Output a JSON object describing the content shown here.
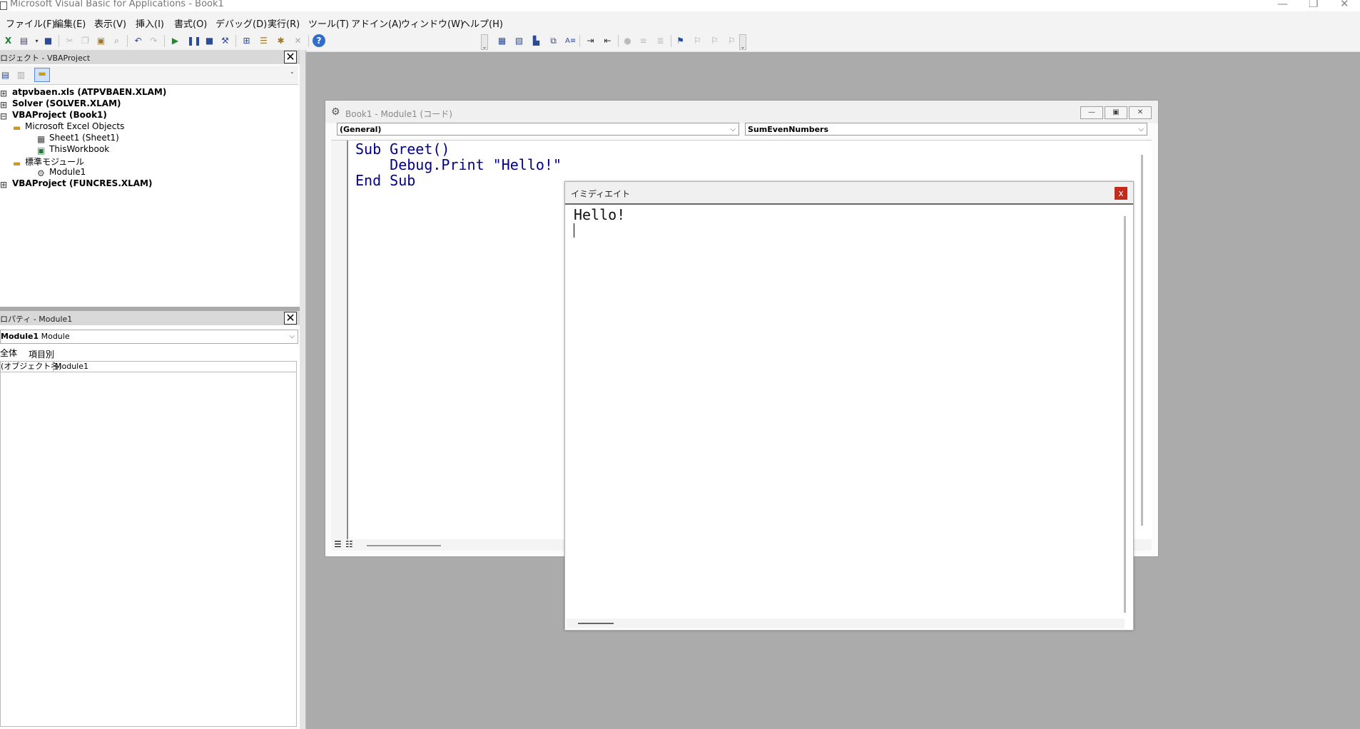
{
  "title_bar": {
    "title": "Microsoft Visual Basic for Applications - Book1"
  },
  "menu": [
    {
      "label": "ファイル(F)"
    },
    {
      "label": "編集(E)"
    },
    {
      "label": "表示(V)"
    },
    {
      "label": "挿入(I)"
    },
    {
      "label": "書式(O)"
    },
    {
      "label": "デバッグ(D)"
    },
    {
      "label": "実行(R)"
    },
    {
      "label": "ツール(T)"
    },
    {
      "label": "アドイン(A)"
    },
    {
      "label": "ウィンドウ(W)"
    },
    {
      "label": "ヘルプ(H)"
    }
  ],
  "project_pane": {
    "title": "ロジェクト - VBAProject",
    "tree": [
      {
        "label": "atpvbaen.xls (ATPVBAEN.XLAM)"
      },
      {
        "label": "Solver (SOLVER.XLAM)"
      },
      {
        "label": "VBAProject (Book1)"
      },
      {
        "label": "Microsoft Excel Objects"
      },
      {
        "label": "Sheet1 (Sheet1)"
      },
      {
        "label": "ThisWorkbook"
      },
      {
        "label": "標準モジュール"
      },
      {
        "label": "Module1"
      },
      {
        "label": "VBAProject (FUNCRES.XLAM)"
      }
    ]
  },
  "properties_pane": {
    "title": "ロパティ - Module1",
    "object_name": "Module1",
    "object_type": "Module",
    "tab_all": "全体",
    "tab_category": "項目別",
    "prop_name": "(オブジェクト名)",
    "prop_value": "Module1"
  },
  "code_window": {
    "title": "Book1 - Module1 (コード)",
    "object_combo": "(General)",
    "proc_combo": "SumEvenNumbers",
    "lines": [
      "Sub Greet()",
      "    Debug.Print \"Hello!\"",
      "End Sub"
    ]
  },
  "immediate_window": {
    "title": "イミディエイト",
    "close_label": "x",
    "output": "Hello!"
  }
}
